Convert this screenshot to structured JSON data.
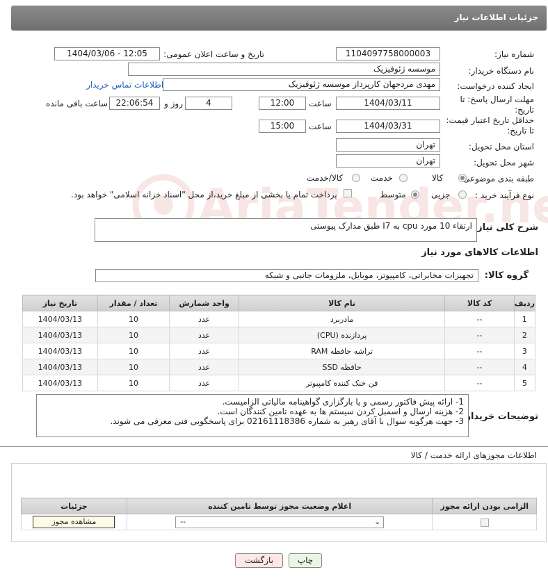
{
  "panel": {
    "title": "جزئیات اطلاعات نیاز"
  },
  "fields": {
    "need_number_label": "شماره نیاز:",
    "need_number": "1104097758000003",
    "announce_label": "تاریخ و ساعت اعلان عمومی:",
    "announce_value": "1404/03/06 - 12:05",
    "buyer_org_label": "نام دستگاه خریدار:",
    "buyer_org": "موسسه ژئوفیزیک",
    "requester_label": "ایجاد کننده درخواست:",
    "requester": "مهدی مردجهان کارپرداز موسسه ژئوفیزیک",
    "contact_link": "اطلاعات تماس خریدار",
    "deadline_label_1": "مهلت ارسال پاسخ: تا",
    "deadline_label_2": "تاریخ:",
    "deadline_date": "1404/03/11",
    "hour_label": "ساعت",
    "deadline_hour": "12:00",
    "days_value": "4",
    "days_label": "روز و",
    "remaining_time": "22:06:54",
    "remaining_label": "ساعت باقی مانده",
    "min_validity_label_1": "حداقل تاریخ اعتبار قیمت:",
    "min_validity_label_2": "تا تاریخ:",
    "validity_date": "1404/03/31",
    "validity_hour": "15:00",
    "province_label": "استان محل تحویل:",
    "province": "تهران",
    "city_label": "شهر محل تحویل:",
    "city": "تهران",
    "category_label": "طبقه بندی موضوعی:",
    "category_options": [
      "کالا",
      "خدمت",
      "کالا/خدمت"
    ],
    "process_label": "نوع فرآیند خرید :",
    "process_options": [
      "جزیی",
      "متوسط"
    ],
    "payment_note": "پرداخت تمام یا بخشی از مبلغ خرید،از محل \"اسناد خزانه اسلامی\" خواهد بود."
  },
  "description": {
    "label": "شرح کلی نیاز:",
    "text": "ارتقاء 10 مورد cpu به I7 طبق مدارک پیوستی"
  },
  "goods": {
    "section_title": "اطلاعات کالاهای مورد نیاز",
    "group_label": "گروه کالا:",
    "group_value": "تجهیزات مخابراتی، کامپیوتر، موبایل، ملزومات جانبی و شبکه",
    "headers": [
      "ردیف",
      "کد کالا",
      "نام کالا",
      "واحد شمارش",
      "تعداد / مقدار",
      "تاریخ نیاز"
    ],
    "rows": [
      [
        "1",
        "--",
        "مادربرد",
        "عدد",
        "10",
        "1404/03/13"
      ],
      [
        "2",
        "--",
        "پردازنده (CPU)",
        "عدد",
        "10",
        "1404/03/13"
      ],
      [
        "3",
        "--",
        "تراشه حافظه RAM",
        "عدد",
        "10",
        "1404/03/13"
      ],
      [
        "4",
        "--",
        "حافظه SSD",
        "عدد",
        "10",
        "1404/03/13"
      ],
      [
        "5",
        "--",
        "فن خنک کننده کامپیوتر",
        "عدد",
        "10",
        "1404/03/13"
      ]
    ]
  },
  "buyer_notes": {
    "label": "توضیحات خریدار:",
    "lines": [
      "1- ارائه پیش فاکتور رسمی و یا بارگزاری گواهینامه مالیاتی الزامیست.",
      "2- هزینه ارسال و اسمبل کردن سیستم ها به عهده تامین کنندگان است.",
      "3-  جهت هرگونه سوال با آقای رهبر به شماره 02161118386 برای پاسخگویی فنی معرفی می شوند."
    ]
  },
  "licenses": {
    "section_title": "اطلاعات مجوزهای ارائه خدمت / کالا",
    "headers": [
      "الزامی بودن ارائه مجوز",
      "اعلام وضعیت مجوز توسط تامین کننده",
      "جزئیات"
    ],
    "select_value": "--",
    "view_button": "مشاهده مجوز"
  },
  "buttons": {
    "print": "چاپ",
    "back": "بازگشت"
  },
  "watermark_text": "AriaTender.neT",
  "colors": {
    "header": "#7a7a7a",
    "link": "#1f5fbf",
    "back_button": "#fde7e7",
    "print_button": "#eaf6e4"
  }
}
